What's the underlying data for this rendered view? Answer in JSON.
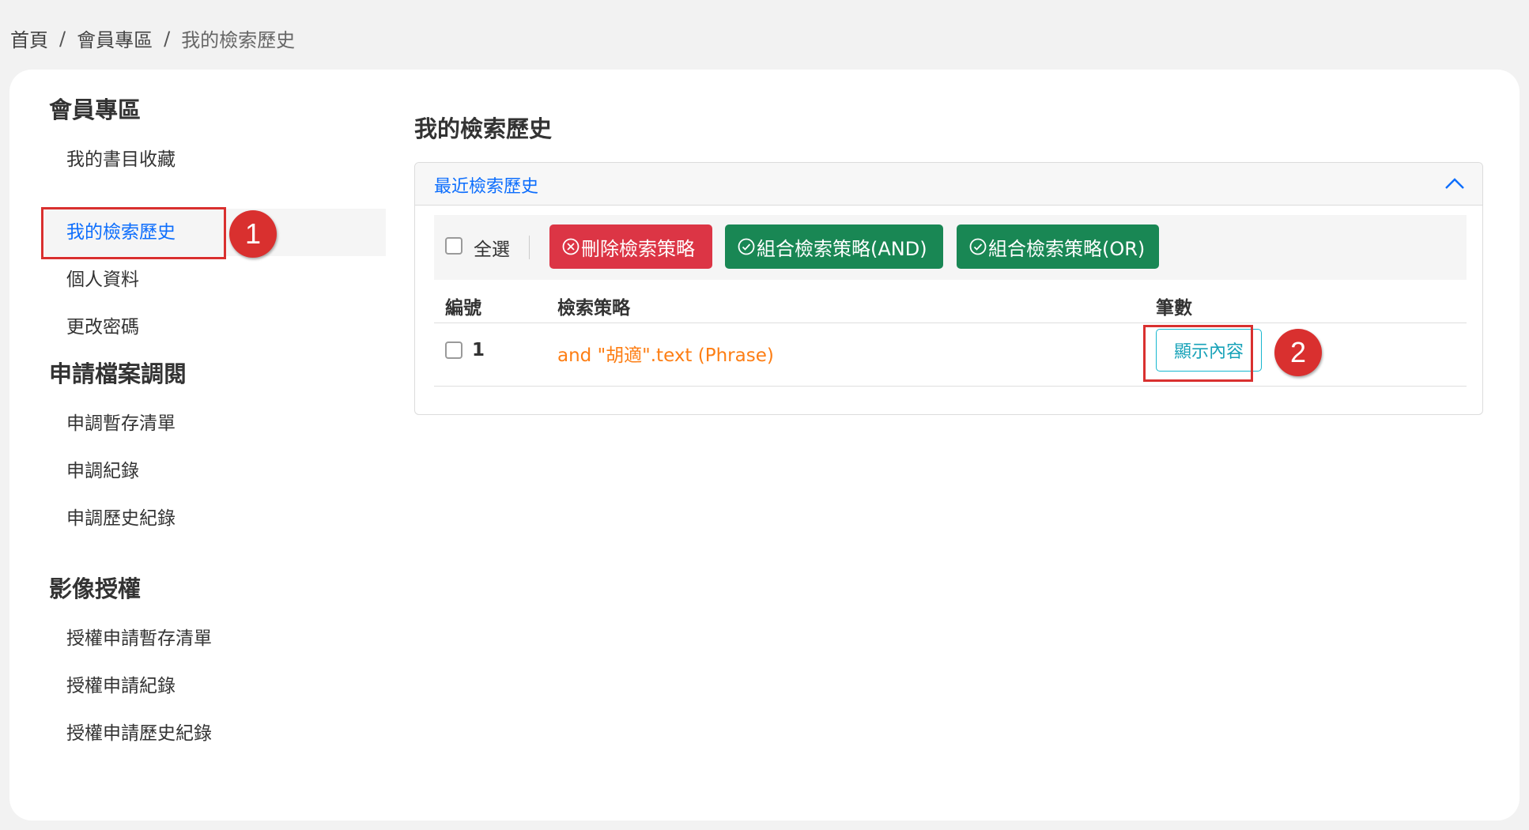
{
  "breadcrumb": {
    "home": "首頁",
    "member": "會員專區",
    "current": "我的檢索歷史",
    "separator": "/"
  },
  "sidebar": {
    "sections": [
      {
        "title": "會員專區",
        "items": [
          {
            "label": "我的書目收藏"
          },
          {
            "label": "我的檢索歷史",
            "active": true
          },
          {
            "label": "個人資料"
          },
          {
            "label": "更改密碼"
          }
        ]
      },
      {
        "title": "申請檔案調閱",
        "items": [
          {
            "label": "申調暫存清單"
          },
          {
            "label": "申調紀錄"
          },
          {
            "label": "申調歷史紀錄"
          }
        ]
      },
      {
        "title": "影像授權",
        "items": [
          {
            "label": "授權申請暫存清單"
          },
          {
            "label": "授權申請紀錄"
          },
          {
            "label": "授權申請歷史紀錄"
          }
        ]
      }
    ]
  },
  "main": {
    "title": "我的檢索歷史",
    "panel": {
      "title": "最近檢索歷史",
      "expanded": true,
      "toolbar": {
        "select_all": "全選",
        "delete_label": "刪除檢索策略",
        "combine_and_label": "組合檢索策略(AND)",
        "combine_or_label": "組合檢索策略(OR)"
      },
      "columns": [
        "編號",
        "檢索策略",
        "筆數"
      ],
      "rows": [
        {
          "no": "1",
          "strategy": "and \"胡適\".text (Phrase)",
          "action": "顯示內容"
        }
      ]
    }
  },
  "annotations": [
    "1",
    "2"
  ],
  "colors": {
    "primary": "#0d6efd",
    "danger": "#dc3545",
    "success": "#198754",
    "info": "#17a2b8",
    "warning_text": "#fd7e14",
    "annotation": "#d9302f"
  }
}
